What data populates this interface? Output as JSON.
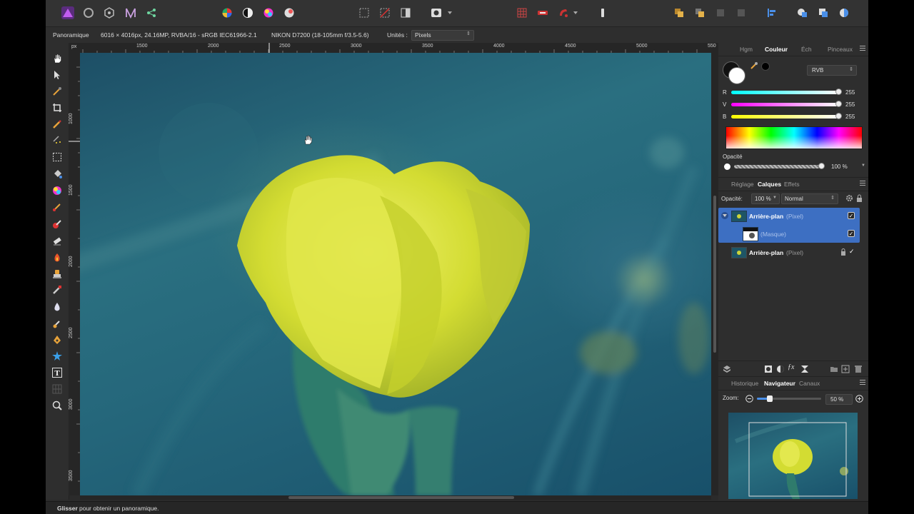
{
  "context": {
    "persona": "Panoramique",
    "doc_info": "6016 × 4016px, 24.16MP, RVBA/16 - sRGB IEC61966-2.1",
    "camera": "NIKON D7200 (18-105mm f/3.5-5.6)",
    "units_label": "Unités :",
    "units_value": "Pixels"
  },
  "ruler": {
    "top": [
      "px",
      "1500",
      "2000",
      "2500",
      "3000",
      "3500",
      "4000",
      "4500",
      "5000",
      "550"
    ],
    "left": [
      "1000",
      "1500",
      "2000",
      "2500",
      "3000",
      "3500"
    ]
  },
  "color_panel": {
    "tabs": [
      "Hgm",
      "Couleur",
      "Éch",
      "Pinceaux"
    ],
    "model": "RVB",
    "r_label": "R",
    "r_value": "255",
    "g_label": "V",
    "g_value": "255",
    "b_label": "B",
    "b_value": "255",
    "opacity_label": "Opacité",
    "opacity_value": "100 %"
  },
  "layers_panel": {
    "tabs": [
      "Réglage",
      "Calques",
      "Effets"
    ],
    "opacity_label": "Opacité:",
    "opacity_value": "100 %",
    "blend_mode": "Normal",
    "layers": [
      {
        "name": "Arrière-plan",
        "type": "(Pixel)"
      },
      {
        "name": "",
        "type": "(Masque)"
      },
      {
        "name": "Arrière-plan",
        "type": "(Pixel)"
      }
    ]
  },
  "navigator_panel": {
    "tabs": [
      "Historique",
      "Navigateur",
      "Canaux"
    ],
    "zoom_label": "Zoom:",
    "zoom_value": "50 %"
  },
  "status": {
    "bold": "Glisser",
    "text": "pour obtenir un panoramique."
  },
  "colors": {
    "accent": "#a33bd6",
    "selection": "#3d6fc2",
    "flower": "#d9e03a"
  }
}
